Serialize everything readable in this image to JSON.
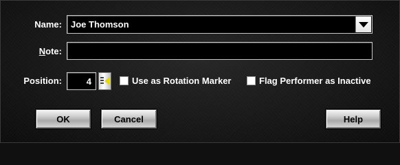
{
  "form": {
    "name_label": "Name:",
    "name_value": "Joe Thomson",
    "note_label_rest": "ote:",
    "note_label_mnemonic": "N",
    "note_value": "",
    "position_label": "Position:",
    "position_value": "4"
  },
  "options": {
    "rotation_marker_label": "Use as Rotation Marker",
    "flag_inactive_label": "Flag Performer as Inactive"
  },
  "buttons": {
    "ok_label": "OK",
    "cancel_label": "Cancel",
    "help_label": "Help"
  },
  "icons": {
    "name_dropdown": "chevron-down-icon",
    "position_spin": "spin-arrow-icon"
  },
  "colors": {
    "background": "#141414",
    "text": "#ffffff",
    "field_border": "#c8c8c8",
    "spin_arrow": "#e6d800"
  }
}
